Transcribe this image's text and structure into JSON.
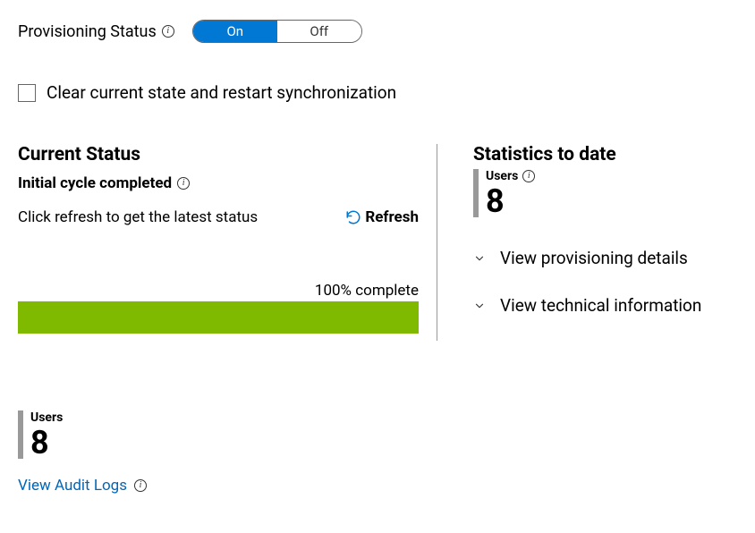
{
  "provisioning": {
    "label": "Provisioning Status",
    "toggle_on": "On",
    "toggle_off": "Off"
  },
  "checkbox": {
    "label": "Clear current state and restart synchronization"
  },
  "current_status": {
    "heading": "Current Status",
    "cycle_label": "Initial cycle completed",
    "helper": "Click refresh to get the latest status",
    "refresh_label": "Refresh",
    "progress_text": "100% complete",
    "progress_percent": 100
  },
  "statistics": {
    "heading": "Statistics to date",
    "users_label": "Users",
    "users_count": "8",
    "expand1": "View provisioning details",
    "expand2": "View technical information"
  },
  "bottom": {
    "users_label": "Users",
    "users_count": "8",
    "audit_link": "View Audit Logs"
  }
}
